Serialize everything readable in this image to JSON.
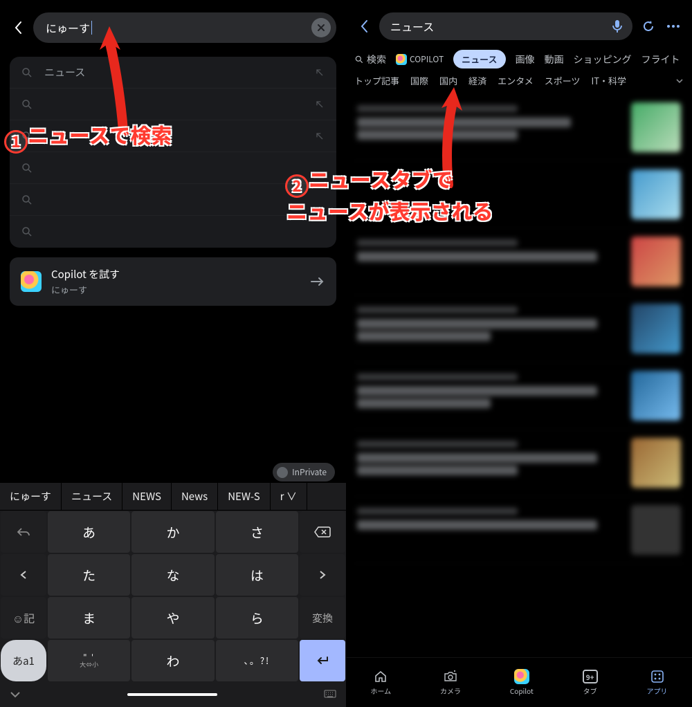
{
  "left": {
    "search_value": "にゅーす",
    "suggestion_first": "ニュース",
    "copilot": {
      "title": "Copilot を試す",
      "sub": "にゅーす"
    },
    "inprivate": "InPrivate",
    "candidates": [
      "にゅーす",
      "ニュース",
      "NEWS",
      "News",
      "NEW-S",
      "r ∨"
    ],
    "keys": {
      "a": "あ",
      "ka": "か",
      "sa": "さ",
      "ta": "た",
      "na": "な",
      "ha": "は",
      "ma": "ま",
      "ya": "や",
      "ra": "ら",
      "wa": "わ",
      "mode": "あa1",
      "henkan": "変換",
      "kigo": "☺記",
      "punct_sub": "大⇔小",
      "punct_sym": "、。?!",
      "punct_top1": "\" '",
      "punct_top2": "°"
    }
  },
  "right": {
    "search_value": "ニュース",
    "tabs": {
      "search": "検索",
      "copilot": "COPILOT",
      "news": "ニュース",
      "image": "画像",
      "video": "動画",
      "shopping": "ショッピング",
      "flight": "フライト"
    },
    "cats": [
      "トップ記事",
      "国際",
      "国内",
      "経済",
      "エンタメ",
      "スポーツ",
      "IT・科学"
    ],
    "nav": {
      "home": "ホーム",
      "camera": "カメラ",
      "copilot": "Copilot",
      "tabs": "タブ",
      "tabs_count": "9+",
      "apps": "アプリ"
    }
  },
  "annotations": {
    "step1": "ニュースで検索",
    "step2_line1": "ニュースタブで",
    "step2_line2": "ニュースが表示される"
  }
}
